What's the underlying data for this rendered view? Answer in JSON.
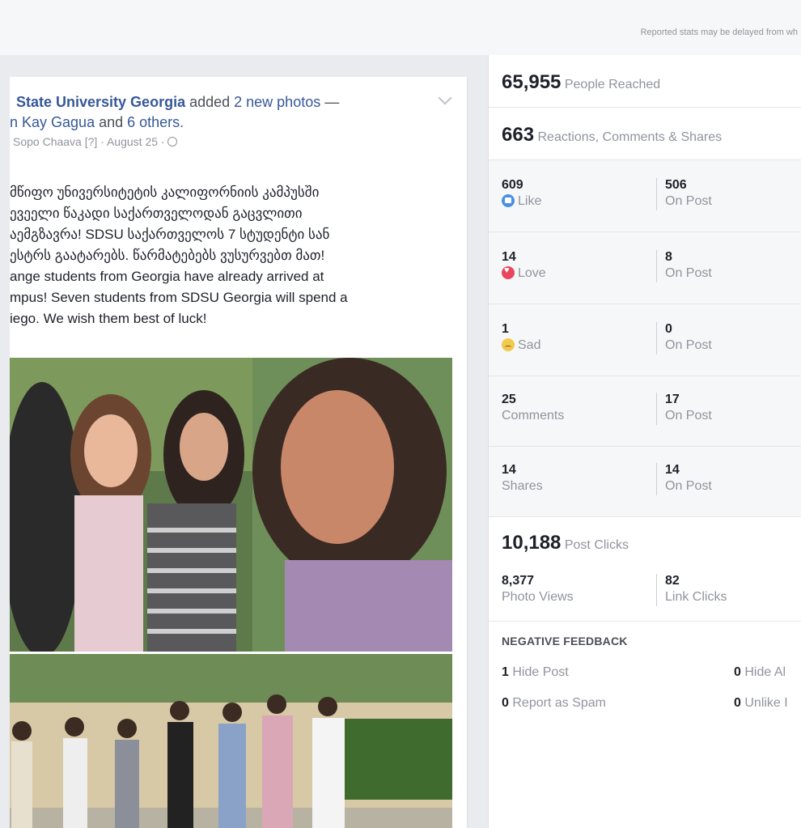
{
  "topbar": {
    "notice": "Reported stats may be delayed from wh"
  },
  "post": {
    "page_name": "State University Georgia",
    "added_text": " added ",
    "photos_link": "2 new photos",
    "dash": " —",
    "with_line": "n Kay Gagua",
    "with_and": " and ",
    "with_others": "6 others.",
    "meta": "Sopo Chaava [?] · August 25 · ",
    "text": "მწიფო უნივერსიტეტის კალიფორნიის კამპუსში\nევეელი წაკადი საქართველოდან გაცვლითი\nაემგზავრა! SDSU საქართველოს 7 სტუდენტი სან\nესტრს გაატარებს. წარმატებებს ვუსურვებთ მათ!\nange students from Georgia have already arrived at\nmpus! Seven students from SDSU Georgia will spend a\niego. We wish them best of luck!"
  },
  "insights": {
    "reached": {
      "value": "65,955",
      "label": "People Reached"
    },
    "engagement": {
      "value": "663",
      "label": "Reactions, Comments & Shares"
    },
    "rows": [
      {
        "left_num": "609",
        "left_label": "Like",
        "icon": "like-icon",
        "right_num": "506",
        "right_label": "On Post"
      },
      {
        "left_num": "14",
        "left_label": "Love",
        "icon": "love-icon",
        "right_num": "8",
        "right_label": "On Post"
      },
      {
        "left_num": "1",
        "left_label": "Sad",
        "icon": "sad-icon",
        "right_num": "0",
        "right_label": "On Post"
      },
      {
        "left_num": "25",
        "left_label": "Comments",
        "icon": "",
        "right_num": "17",
        "right_label": "On Post"
      },
      {
        "left_num": "14",
        "left_label": "Shares",
        "icon": "",
        "right_num": "14",
        "right_label": "On Post"
      }
    ],
    "clicks": {
      "value": "10,188",
      "label": "Post Clicks",
      "photo_views": "8,377",
      "photo_views_label": "Photo Views",
      "link_clicks": "82",
      "link_clicks_label": "Link Clicks"
    },
    "negative": {
      "title": "NEGATIVE FEEDBACK",
      "hide_post_num": "1",
      "hide_post_label": "Hide Post",
      "hide_all_num": "0",
      "hide_all_label": "Hide Al",
      "spam_num": "0",
      "spam_label": "Report as Spam",
      "unlike_num": "0",
      "unlike_label": "Unlike I"
    }
  }
}
